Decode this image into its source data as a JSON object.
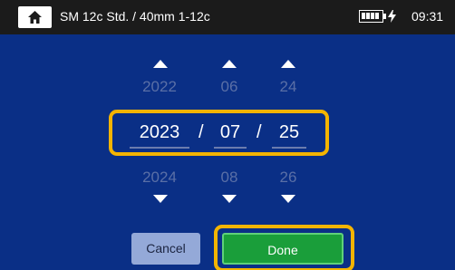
{
  "header": {
    "home_icon": "home-icon",
    "title": "SM 12c Std. / 40mm 1-12c",
    "battery_icon": "battery-charging-icon",
    "time": "09:31"
  },
  "date_picker": {
    "year": {
      "prev": "2022",
      "current": "2023",
      "next": "2024"
    },
    "month": {
      "prev": "06",
      "current": "07",
      "next": "08"
    },
    "day": {
      "prev": "24",
      "current": "25",
      "next": "26"
    },
    "separator": "/",
    "highlight_color": "#f4b400"
  },
  "actions": {
    "cancel_label": "Cancel",
    "done_label": "Done"
  },
  "colors": {
    "background": "#0a2f86",
    "header": "#1b1b1b",
    "done": "#1a9e3a",
    "cancel": "#94a9d8"
  }
}
